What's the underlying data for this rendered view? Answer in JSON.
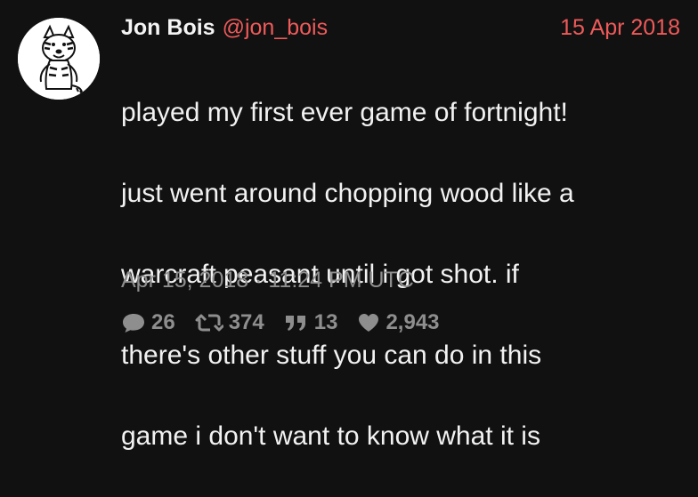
{
  "tweet": {
    "author_name": "Jon Bois",
    "handle": "@jon_bois",
    "date_link": "15 Apr 2018",
    "lines": [
      "played my first ever game of fortnight!",
      "just went around chopping wood like a",
      "warcraft peasant until i got shot. if",
      "there's other stuff you can do in this",
      "game i don't want to know what it is"
    ],
    "timestamp": "Apr 15, 2018 · 11:24 PM UTC",
    "stats": {
      "replies": "26",
      "retweets": "374",
      "quotes": "13",
      "likes": "2,943"
    }
  },
  "colors": {
    "background": "#111111",
    "accent": "#ef5a5a",
    "text": "#f2f2f2",
    "muted": "#8e8e8e"
  },
  "icons": {
    "reply": "comment-bubble-icon",
    "retweet": "retweet-icon",
    "quote": "quote-icon",
    "like": "heart-icon"
  }
}
